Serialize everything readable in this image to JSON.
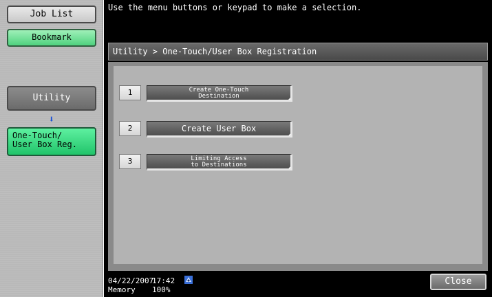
{
  "sidebar": {
    "job_list_label": "Job List",
    "bookmark_label": "Bookmark",
    "utility_label": "Utility",
    "arrow_glyph": "⬇",
    "current_line1": "One-Touch/",
    "current_line2": "User Box Reg."
  },
  "message": "Use the menu buttons or keypad to make a selection.",
  "breadcrumb": "Utility > One-Touch/User Box Registration",
  "menu": [
    {
      "number": "1",
      "line1": "Create One-Touch",
      "line2": "Destination"
    },
    {
      "number": "2",
      "label": "Create User Box"
    },
    {
      "number": "3",
      "line1": "Limiting Access",
      "line2": "to Destinations"
    }
  ],
  "status": {
    "date": "04/22/2007",
    "time": "17:42",
    "memory_label": "Memory",
    "memory_value": "100%",
    "network_icon": "network-icon"
  },
  "close_label": "Close",
  "colors": {
    "bookmark": "#4fd27f",
    "current_item": "#21c46a",
    "arrow": "#1e54d6"
  }
}
